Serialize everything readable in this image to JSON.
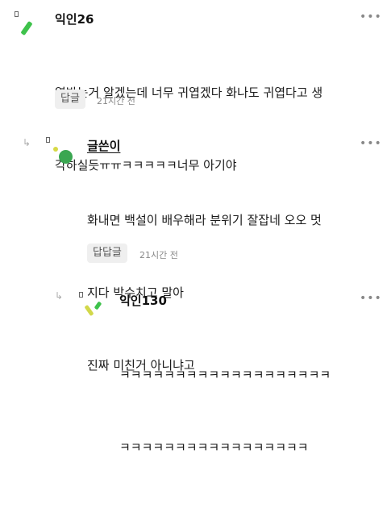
{
  "comments": [
    {
      "author": "익인26",
      "lines": [
        "열받는거 알겠는데 너무 귀엽겠다 화나도 귀엽다고 생",
        "각하실듯ㅠㅠㅋㅋㅋㅋㅋ너무 아기야"
      ],
      "reply_label": "답글",
      "time": "21시간 전",
      "more_icon": "ellipsis-icon"
    },
    {
      "author": "글쓴이",
      "lines": [
        "화내면 백설이 배우해라 분위기 잘잡네 오오 멋",
        "지다 박수치고 말아",
        "진짜 미친거 아니냐고"
      ],
      "reply_label": "답답글",
      "time": "21시간 전",
      "more_icon": "ellipsis-icon"
    },
    {
      "author": "익인130",
      "lines": [
        "ㅋㅋㅋㅋㅋㅋㅋㅋㅋㅋㅋㅋㅋㅋㅋㅋㅋㅋㅋ",
        "ㅋㅋㅋㅋㅋㅋㅋㅋㅋㅋㅋㅋㅋㅋㅋㅋㅋ"
      ],
      "more_icon": "ellipsis-icon"
    }
  ],
  "colors": {
    "green_stick": "#3ec24b",
    "writer_dot_green": "#3aa651",
    "writer_dot_yellow": "#d7d946",
    "yellow_stick": "#d2d84a"
  }
}
